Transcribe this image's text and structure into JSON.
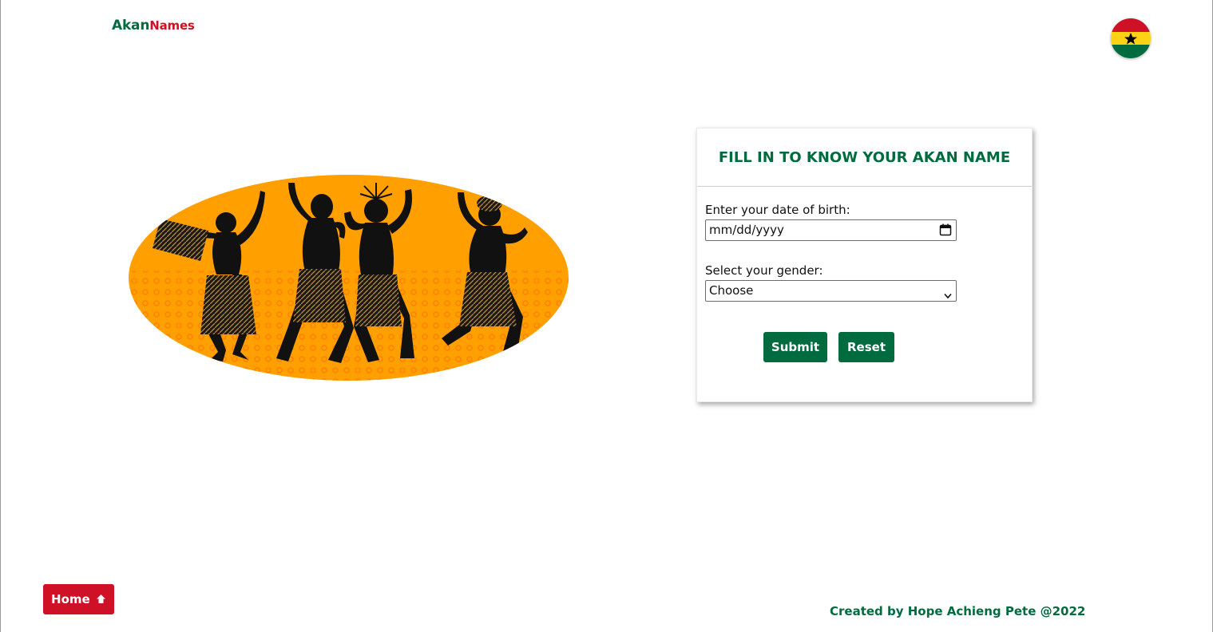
{
  "header": {
    "logo_part1": "Akan",
    "logo_part2": "Names",
    "flag_icon": "ghana-flag-icon"
  },
  "colors": {
    "green": "#006b3f",
    "red": "#ce1126",
    "gold": "#fcd116",
    "orange": "#ff9f00"
  },
  "hero": {
    "image": "african-dancers-illustration"
  },
  "form": {
    "title": "FILL IN TO KNOW YOUR AKAN NAME",
    "dob_label": "Enter your date of birth:",
    "dob_placeholder": "mm/dd/yyyy",
    "gender_label": "Select your gender:",
    "gender_selected": "Choose",
    "submit_label": "Submit",
    "reset_label": "Reset"
  },
  "footer": {
    "home_label": "Home",
    "credit": "Created by Hope Achieng Pete @2022"
  }
}
